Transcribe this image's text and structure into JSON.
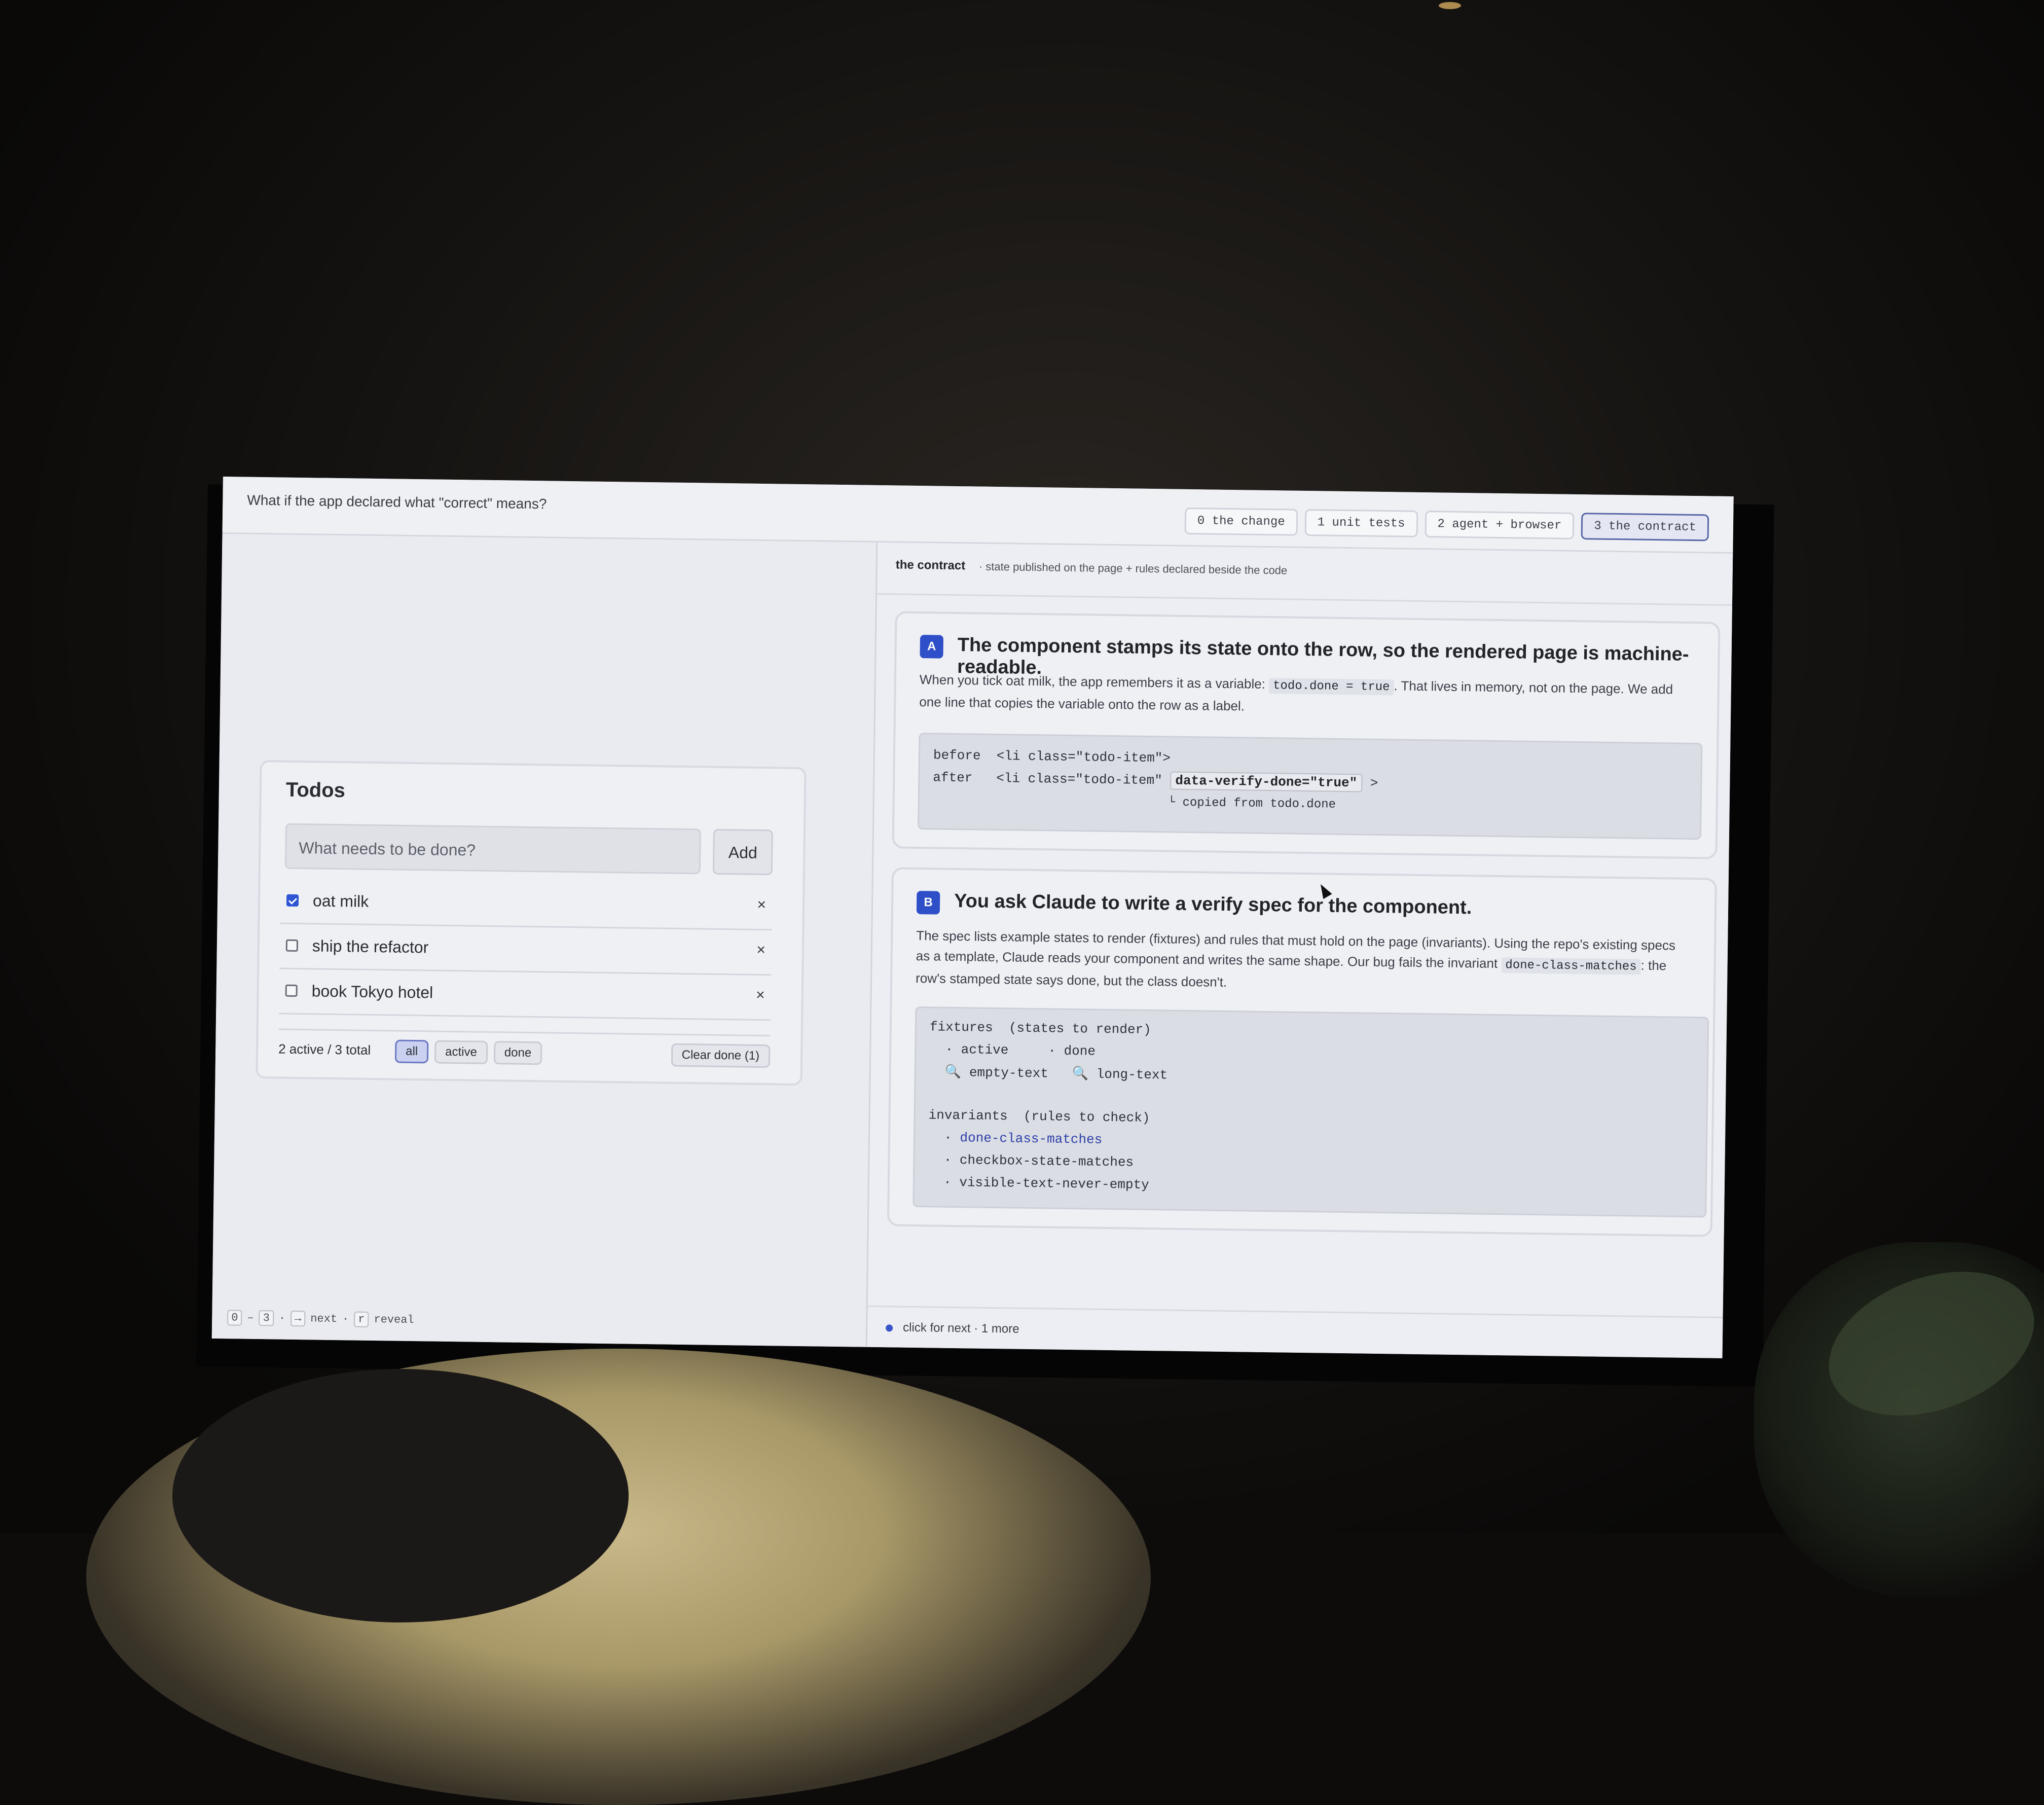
{
  "header": {
    "question": "What if the app declared what \"correct\" means?",
    "steps": [
      {
        "label": "0 the change"
      },
      {
        "label": "1 unit tests"
      },
      {
        "label": "2 agent + browser"
      },
      {
        "label": "3 the contract",
        "active": true
      }
    ]
  },
  "todo": {
    "title": "Todos",
    "input_placeholder": "What needs to be done?",
    "add_label": "Add",
    "items": [
      {
        "label": "oat milk",
        "done": true,
        "delete": "×"
      },
      {
        "label": "ship the refactor",
        "done": false,
        "delete": "×"
      },
      {
        "label": "book Tokyo hotel",
        "done": false,
        "delete": "×"
      }
    ],
    "count": "2 active / 3 total",
    "filters": [
      "all",
      "active",
      "done"
    ],
    "active_filter": "all",
    "clear_label": "Clear done (1)"
  },
  "keyboard_hints": {
    "range_start": "0",
    "range_dash": "–",
    "range_end": "3",
    "sep1": "·",
    "next_key": "→",
    "next_label": "next",
    "sep2": "·",
    "reveal_key": "r",
    "reveal_label": "reveal"
  },
  "panel": {
    "title": "the contract",
    "subtitle": "· state published on the page + rules declared beside the code"
  },
  "card_a": {
    "badge": "A",
    "title": "The component stamps its state onto the row, so the rendered page is machine-readable.",
    "body_1": "When you tick oat milk, the app remembers it as a variable: ",
    "body_code": "todo.done = true",
    "body_2": ". That lives in memory, not on the page. We add one line that copies the variable onto the row as a label.",
    "code": {
      "before": "before  <li class=\"todo-item\">",
      "after": "after   <li class=\"todo-item\" ",
      "attr": "data-verify-done=\"true\"",
      "after_close": " >",
      "note": "└ copied from todo.done"
    }
  },
  "card_b": {
    "badge": "B",
    "title": "You ask Claude to write a verify spec for the component.",
    "body_1": "The spec lists example states to render (fixtures) and rules that must hold on the page (invariants). Using the repo's existing specs as a template, Claude reads your component and writes the same shape. Our bug fails the invariant ",
    "body_code": "done-class-matches",
    "body_2": ": the row's stamped state says done, but the class doesn't.",
    "code": {
      "fixtures_header": "fixtures  (states to render)",
      "fixtures_row1": "  · active     · done",
      "fixtures_row2": "  🔍 empty-text   🔍 long-text",
      "invariants_header": "invariants  (rules to check)",
      "invariant_1": "done-class-matches",
      "invariant_2": "checkbox-state-matches",
      "invariant_3": "visible-text-never-empty",
      "bullet": "  · "
    }
  },
  "footer": {
    "text": "click for next · 1 more"
  },
  "colors": {
    "accent": "#2f4fc8",
    "screen_bg": "#eceef3"
  }
}
